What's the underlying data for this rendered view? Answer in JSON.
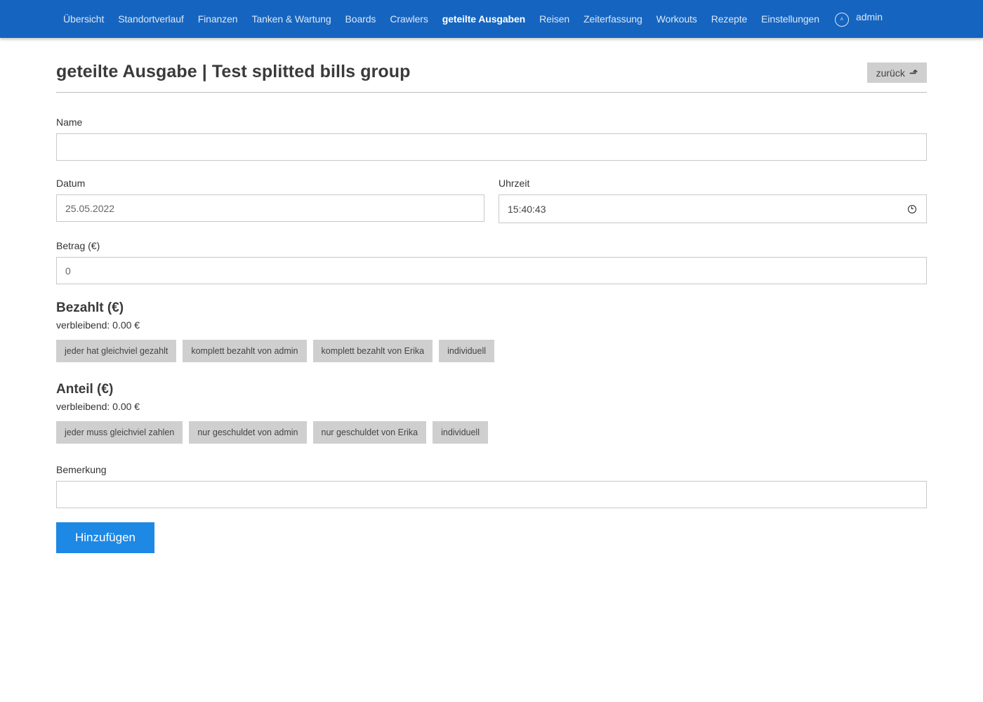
{
  "nav": {
    "items": [
      {
        "label": "Übersicht"
      },
      {
        "label": "Standortverlauf"
      },
      {
        "label": "Finanzen"
      },
      {
        "label": "Tanken & Wartung"
      },
      {
        "label": "Boards"
      },
      {
        "label": "Crawlers"
      },
      {
        "label": "geteilte Ausgaben"
      },
      {
        "label": "Reisen"
      },
      {
        "label": "Zeiterfassung"
      },
      {
        "label": "Workouts"
      },
      {
        "label": "Rezepte"
      },
      {
        "label": "Einstellungen"
      }
    ],
    "active_item": "geteilte Ausgaben",
    "user_initial": "A",
    "user_name": "admin"
  },
  "header": {
    "title": "geteilte Ausgabe | Test splitted bills group",
    "back_label": "zurück",
    "back_icon": "arrow-up-icon"
  },
  "form": {
    "name": {
      "label": "Name",
      "value": ""
    },
    "date": {
      "label": "Datum",
      "value": "25.05.2022"
    },
    "time": {
      "label": "Uhrzeit",
      "value": "15:40:43",
      "icon": "clock-icon"
    },
    "amount": {
      "label": "Betrag (€)",
      "value": "0"
    },
    "paid": {
      "heading": "Bezahlt (€)",
      "remaining": "verbleibend: 0.00 €",
      "options": [
        "jeder hat gleichviel gezahlt",
        "komplett bezahlt von admin",
        "komplett bezahlt von Erika",
        "individuell"
      ]
    },
    "share": {
      "heading": "Anteil (€)",
      "remaining": "verbleibend: 0.00 €",
      "options": [
        "jeder muss gleichviel zahlen",
        "nur geschuldet von admin",
        "nur geschuldet von Erika",
        "individuell"
      ]
    },
    "note": {
      "label": "Bemerkung",
      "value": ""
    },
    "submit_label": "Hinzufügen"
  },
  "colors": {
    "navbar": "#1565c0",
    "primary_button": "#1e88e5",
    "secondary_button": "#cfcfcf"
  }
}
